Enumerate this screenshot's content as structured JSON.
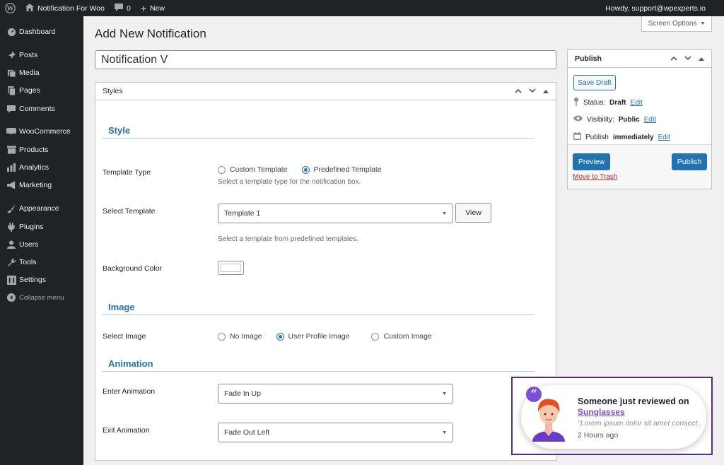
{
  "adminbar": {
    "site_name": "Notification For Woo",
    "comments_count": "0",
    "new_label": "New",
    "howdy": "Howdy, support@wpexperts.io"
  },
  "sidebar": {
    "items": [
      {
        "label": "Dashboard",
        "icon": "dashboard-icon"
      },
      {
        "label": "Posts",
        "icon": "pin-icon"
      },
      {
        "label": "Media",
        "icon": "media-icon"
      },
      {
        "label": "Pages",
        "icon": "pages-icon"
      },
      {
        "label": "Comments",
        "icon": "comment-icon"
      },
      {
        "label": "WooCommerce",
        "icon": "woo-icon"
      },
      {
        "label": "Products",
        "icon": "archive-icon"
      },
      {
        "label": "Analytics",
        "icon": "bar-chart-icon"
      },
      {
        "label": "Marketing",
        "icon": "megaphone-icon"
      },
      {
        "label": "Appearance",
        "icon": "brush-icon"
      },
      {
        "label": "Plugins",
        "icon": "plug-icon"
      },
      {
        "label": "Users",
        "icon": "user-icon"
      },
      {
        "label": "Tools",
        "icon": "wrench-icon"
      },
      {
        "label": "Settings",
        "icon": "settings-icon"
      },
      {
        "label": "Collapse menu",
        "icon": "collapse-icon"
      }
    ]
  },
  "page": {
    "title": "Add New Notification",
    "screen_options": "Screen Options",
    "post_title_value": "Notification V"
  },
  "styles_box": {
    "header": "Styles",
    "style_section": "Style",
    "template_type_label": "Template Type",
    "template_type_options": [
      "Custom Template",
      "Predefined Template"
    ],
    "template_type_selected": "Predefined Template",
    "template_type_desc": "Select a template type for the notification box.",
    "select_template_label": "Select Template",
    "select_template_value": "Template 1",
    "view_button": "View",
    "select_template_desc": "Select a template from predefined templates.",
    "bg_color_label": "Background Color",
    "bg_color_value": "#ffffff",
    "image_section": "Image",
    "select_image_label": "Select Image",
    "image_options": [
      "No Image",
      "User Profile Image",
      "Custom Image"
    ],
    "image_selected": "User Profile Image",
    "animation_section": "Animation",
    "enter_animation_label": "Enter Animation",
    "enter_animation_value": "Fade In Up",
    "exit_animation_label": "Exit Animation",
    "exit_animation_value": "Fade Out Left"
  },
  "publish_box": {
    "header": "Publish",
    "save_draft": "Save Draft",
    "status_label": "Status:",
    "status_value": "Draft",
    "visibility_label": "Visibility:",
    "visibility_value": "Public",
    "publish_label": "Publish",
    "publish_value": "immediately",
    "edit_link": "Edit",
    "preview": "Preview",
    "publish_button": "Publish",
    "move_to_trash": "Move to Trash"
  },
  "notification_preview": {
    "title": "Someone just reviewed on",
    "product": "Sunglasses",
    "text": "\"Lorem ipsum dolor sit amet consect...",
    "time": "2 Hours ago"
  },
  "colors": {
    "admin_dark": "#1d2327",
    "primary": "#2271b1",
    "accent_purple": "#7b4fd6",
    "frame_purple": "#5b2a86",
    "trash_red": "#b32d2e"
  }
}
